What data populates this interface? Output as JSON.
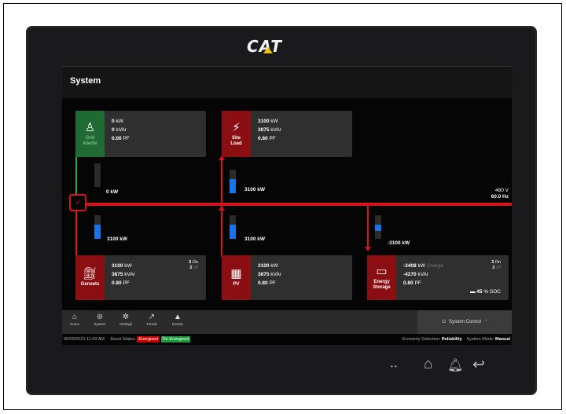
{
  "brand": "CAT",
  "title": "System",
  "grid": {
    "icon_label": "Grid\nIntertie",
    "line1": "0",
    "line1_unit": "kW",
    "line2": "0",
    "line2_unit": "kVAr",
    "line3": "0.00",
    "line3_unit": "PF",
    "flow": "0 kW",
    "flow_level": 0
  },
  "site_load": {
    "icon_label": "Site\nLoad",
    "line1": "3100",
    "line1_unit": "kW",
    "line2": "3875",
    "line2_unit": "kVAr",
    "line3": "0.80",
    "line3_unit": "PF",
    "flow": "3100 kW",
    "flow_level": 0.6
  },
  "bus": {
    "voltage": "480 V",
    "frequency": "60.0 Hz"
  },
  "gensets": {
    "icon_label": "Gensets",
    "line1": "3100",
    "line1_unit": "kW",
    "line2": "3875",
    "line2_unit": "kVAr",
    "line3": "0.80",
    "line3_unit": "PF",
    "on_count": "3",
    "on_label": "On",
    "off_count": "2",
    "off_label": "off",
    "flow": "3100 kW",
    "flow_level": 0.6
  },
  "pv": {
    "icon_label": "PV",
    "line1": "3100",
    "line1_unit": "kW",
    "line2": "3875",
    "line2_unit": "kVAr",
    "line3": "0.80",
    "line3_unit": "PF",
    "flow": "3100 kW",
    "flow_level": 0.6
  },
  "storage": {
    "icon_label": "Energy\nStorage",
    "line1": "-3408",
    "line1_unit": "kW",
    "mode": "Charge",
    "line2": "-4270",
    "line2_unit": "kVAr",
    "line3": "0.80",
    "line3_unit": "PF",
    "on_count": "3",
    "on_label": "On",
    "off_count": "2",
    "off_label": "off",
    "soc_value": "45",
    "soc_unit": "% SOC",
    "flow": "-3100 kW",
    "flow_level": 0.25
  },
  "nav": {
    "items": [
      {
        "label": "Home",
        "icon": "home-icon",
        "glyph": "⌂"
      },
      {
        "label": "System",
        "icon": "globe-icon",
        "glyph": "⊕"
      },
      {
        "label": "Settings",
        "icon": "gear-icon",
        "glyph": "✲"
      },
      {
        "label": "Trends",
        "icon": "trend-icon",
        "glyph": "↗"
      },
      {
        "label": "Events",
        "icon": "warning-icon",
        "glyph": "▲"
      }
    ],
    "system_control": "System Control",
    "power_glyph": "⏻",
    "caret": "^"
  },
  "status": {
    "datetime": "06/09/2021 11:43 AM",
    "asset_states_label": "Asset States:",
    "energized": "Energized",
    "de_energized": "De-Energized",
    "economy_label": "Economy Selection:",
    "economy_value": "Reliability",
    "mode_label": "System Mode:",
    "mode_value": "Manual"
  },
  "hardware": {
    "dots": "• •",
    "home": "⌂",
    "bell": "🔔︎",
    "back": "↩"
  },
  "colors": {
    "accent_red": "#d7141a",
    "icon_red": "#8b0f12",
    "grid_green": "#1f6b33",
    "fill_blue": "#1a74e8",
    "energized": "#cc0000",
    "de_energized": "#1a9a3a",
    "cat_yellow": "#f4c20d"
  }
}
